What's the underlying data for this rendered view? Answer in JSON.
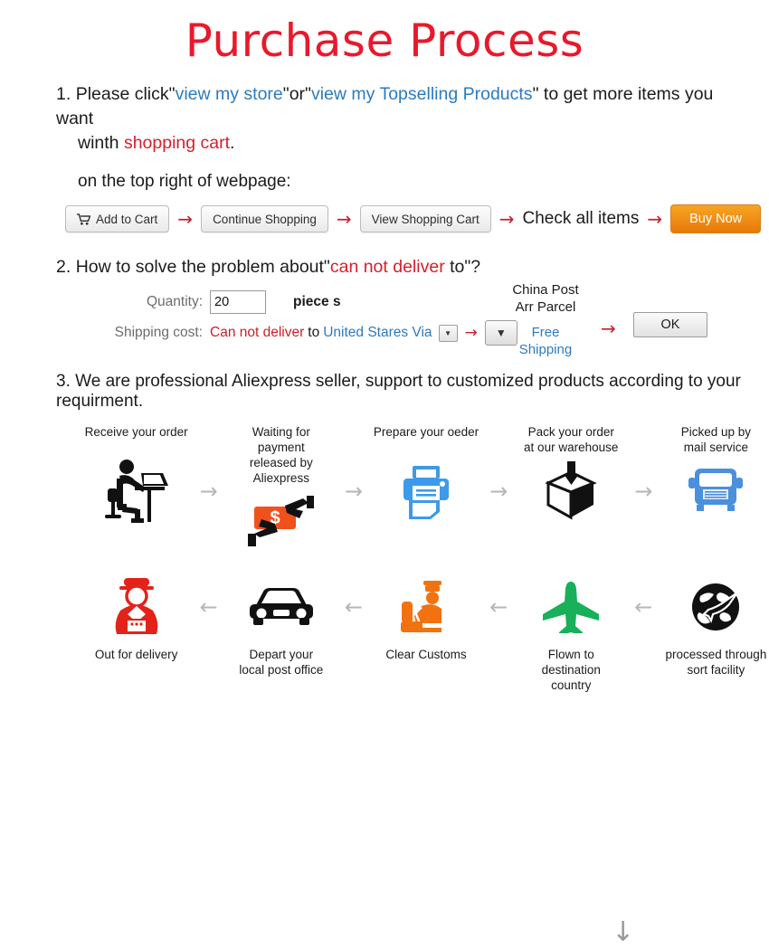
{
  "title": "Purchase Process",
  "section1": {
    "num": "1.",
    "t1": "Please click\"",
    "link1": "view my store",
    "t2": "\"or\"",
    "link2": "view my Topselling Products",
    "t3": "\" to get more items you want",
    "t4": "winth ",
    "red1": "shopping cart",
    "t5": ".",
    "note": "on the top right of webpage:",
    "buttons": {
      "add_to_cart": "Add to Cart",
      "continue_shopping": "Continue Shopping",
      "view_shopping_cart": "View Shopping Cart",
      "check_all_items": "Check all items",
      "buy_now": "Buy Now"
    },
    "arrow": "→"
  },
  "section2": {
    "num": "2.",
    "head_a": "How to solve the problem about\"",
    "head_red": "can not deliver",
    "head_b": " to\"?",
    "quantity_label": "Quantity:",
    "quantity_value": "20",
    "piece_label": "piece s",
    "shipping_label": "Shipping cost:",
    "shipping_red": "Can not deliver",
    "shipping_to": "to",
    "shipping_blue": "United Stares Via",
    "carrier_line1": "China Post",
    "carrier_line2": "Arr Parcel",
    "free_line1": "Free",
    "free_line2": "Shipping",
    "ok_label": "OK",
    "arrow": "→",
    "caret": "▼"
  },
  "section3": {
    "num": "3.",
    "head": "We are professional Aliexpress seller, support to customized products according to your requirment.",
    "arrow_right": "→",
    "arrow_left": "←",
    "arrow_down": "↓",
    "top_steps": [
      {
        "label": "Receive your order",
        "icon": "person-at-desk-icon"
      },
      {
        "label": "Waiting for payment\nreleased by Aliexpress",
        "icon": "cash-handoff-icon"
      },
      {
        "label": "Prepare your oeder",
        "icon": "printer-icon"
      },
      {
        "label": "Pack your order\nat our warehouse",
        "icon": "packing-box-icon"
      },
      {
        "label": "Picked up by\nmail service",
        "icon": "truck-icon"
      }
    ],
    "bottom_steps": [
      {
        "label": "Out for delivery",
        "icon": "delivery-man-icon"
      },
      {
        "label": "Depart your\nlocal post office",
        "icon": "car-icon"
      },
      {
        "label": "Clear Customs",
        "icon": "customs-officer-icon"
      },
      {
        "label": "Flown to destination\ncountry",
        "icon": "airplane-icon"
      },
      {
        "label": "processed through\nsort facility",
        "icon": "global-sort-icon"
      }
    ]
  },
  "colors": {
    "title_red": "#e8192c",
    "link_blue": "#2b7bbf",
    "accent_red": "#d6202a",
    "buy_orange": "#e8780a",
    "icon_blue": "#3d9ae8",
    "icon_orange": "#f1720f",
    "icon_green": "#18b05a",
    "arrow_grey": "#b6b6b6"
  }
}
